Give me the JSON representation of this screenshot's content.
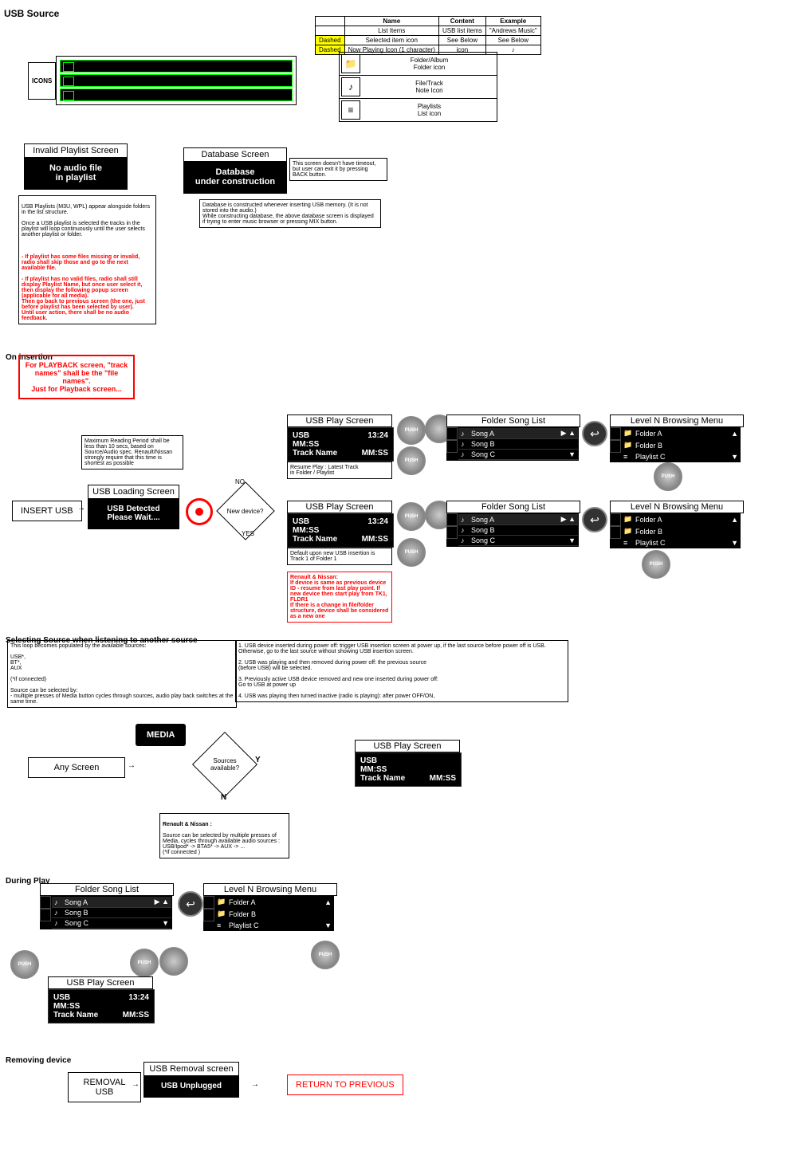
{
  "title": "USB Source",
  "legend": {
    "headers": [
      "",
      "Name",
      "Content",
      "Example"
    ],
    "rows": [
      [
        "",
        "List Items",
        "USB list items",
        "\"Andrews Music\""
      ],
      [
        "Dashed",
        "Selected item icon",
        "See Below",
        "See Below"
      ],
      [
        "Dashed",
        "Now Playing Icon (1 character)",
        "icon",
        "♪"
      ]
    ]
  },
  "icons_label": "ICONS",
  "icon_legend": [
    {
      "icon": "📁",
      "line1": "Folder/Album",
      "line2": "Folder icon"
    },
    {
      "icon": "♪",
      "line1": "File/Track",
      "line2": "Note Icon"
    },
    {
      "icon": "≡",
      "line1": "Playlists",
      "line2": "List icon"
    }
  ],
  "invalid_playlist": {
    "header": "Invalid Playlist Screen",
    "body1": "No audio file",
    "body2": "in playlist"
  },
  "database_screen": {
    "header": "Database Screen",
    "body1": "Database",
    "body2": "under construction",
    "note": "This screen doesn't have timeout, but user can exit it by pressing BACK button."
  },
  "playlist_note_plain": "USB Playlists (M3U, WPL)  appear alongside folders in the list structure.\n\nOnce a USB playlist is selected the tracks in the playlist will loop continuously until the user selects another playlist or folder.",
  "playlist_note_red": "- If playlist has some files missing or invalid, radio shall skip those and go to the next available file.\n\n  - If playlist has no valid files, radio shall still display Playlist Name, but once user select it, then display the following popup screen (applicable for all media).\nThen go back to previous screen (the one, just before playlist has been selected by user).\nUntil user action, there shall be no audio feedback.",
  "database_note": "Database is constructed whenever inserting USB memory. (It is not stored into the audio.)\nWhile constructing database, the above database screen is displayed if trying to enter music browser or pressing MIX button.",
  "on_insertion": "On insertion",
  "playback_red": "For PLAYBACK screen, \"track names\" shall be the \"file names\".\nJust for Playback screen...",
  "reading_note": "Maximum Reading Period shall be less than 10 secs, based on Source/Audio spec. Renault/Nissan strongly require that this time is shortest as possible",
  "insert_usb": "INSERT USB",
  "loading": {
    "header": "USB Loading Screen",
    "body1": "USB  Detected",
    "body2": "Please Wait...."
  },
  "decision": {
    "label": "New device?",
    "no": "NO",
    "yes": "YES"
  },
  "usb_play": {
    "header": "USB Play Screen",
    "line1": "USB",
    "time": "13:24",
    "line2": "MM:SS",
    "line3": "Track Name",
    "dur": "MM:SS"
  },
  "resume_note": "Resume Play : Latest Track\n                     in Folder / Playlist",
  "default_note": "Default upon new USB insertion is Track 1 of Folder 1",
  "renault_red": "Renault & Nissan:\n If device is same as previous device ID - resume from last play point. If new device then start play from TK1, FLDR1\nIf there is a change in file/folder structure, device shall be considered as a new one",
  "folder_list": {
    "header": "Folder Song List",
    "items": [
      "Song A",
      "Song B",
      "Song C"
    ]
  },
  "browsing": {
    "header": "Level N Browsing Menu",
    "items": [
      {
        "icon": "📁",
        "label": "Folder A"
      },
      {
        "icon": "📁",
        "label": "Folder B"
      },
      {
        "icon": "≡",
        "label": "Playlist C"
      }
    ]
  },
  "push": "PUSH",
  "selecting_source_title": "Selecting Source when listening to another source",
  "source_loop_note": "This loop becomes populated by the available sources:\n\nUSB*,\nBT*,\nAUX\n\n(*if connected)\n\nSource can be selected by:\n- multiple presses of Media button cycles through sources,  audio play back switches at the same time.",
  "source_rules": "1. USB device inserted during power off: trigger USB insertion screen at power up, if the last source before power off is USB. Otherwise, go to the last source without showing USB insertion screen.\n\n2. USB was playing and then removed during power off: the previous source\n    (before USB) will be selected.\n\n3. Previously active USB device removed and new one inserted during power off:\n    Go to USB at power up\n\n4. USB was playing then turned inactive (radio is playing): after power OFF/ON,",
  "any_screen": "Any Screen",
  "media": "MEDIA",
  "sources_avail": "Sources available?",
  "y": "Y",
  "n": "N",
  "renault_media_note": "Renault & Nissan :\nSource can be selected by multiple presses of Media, cycles through available audio sources :\nUSB/Ipod* -> BTA5* -> AUX -> ...\n(*if connected )",
  "during_play": "During Play",
  "removing": "Removing device",
  "removal_usb": "REMOVAL USB",
  "removal_screen": {
    "header": "USB Removal screen",
    "body": "USB  Unplugged"
  },
  "return_prev": "RETURN TO PREVIOUS"
}
